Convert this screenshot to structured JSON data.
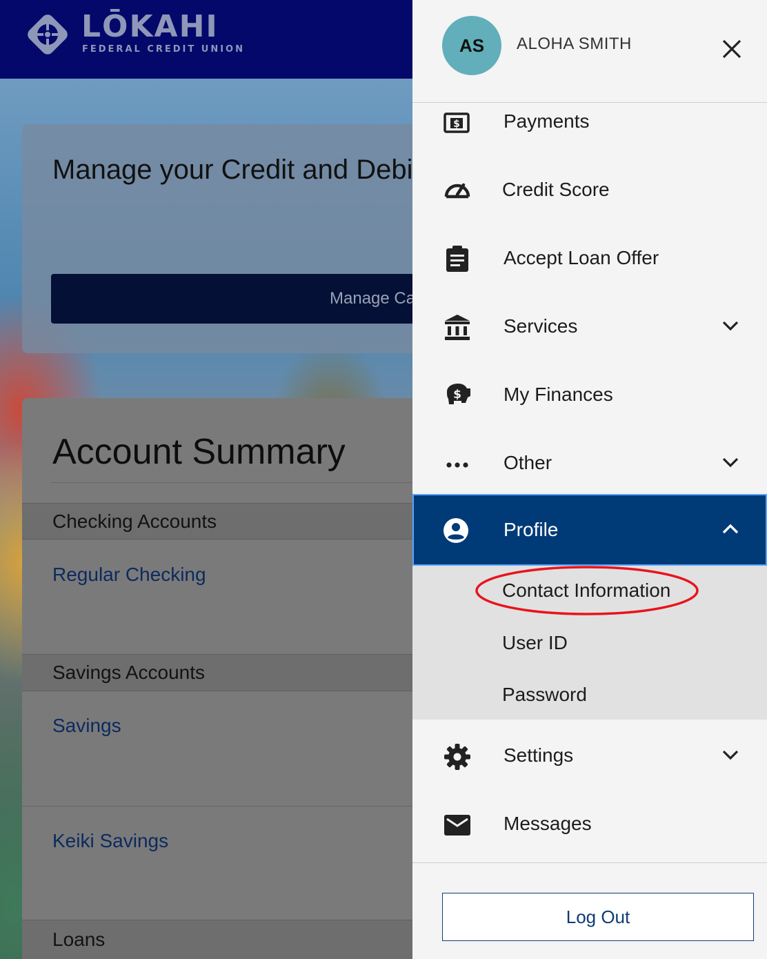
{
  "header": {
    "logo_name": "LŌKAHI",
    "logo_sub": "FEDERAL CREDIT UNION"
  },
  "cards_panel": {
    "title": "Manage your Credit and Debit",
    "button_label": "Manage Car"
  },
  "summary": {
    "title": "Account Summary",
    "sections": {
      "checking": "Checking Accounts",
      "savings": "Savings Accounts",
      "loans": "Loans"
    },
    "accounts": {
      "regular_checking": "Regular Checking",
      "savings": "Savings",
      "keiki_savings": "Keiki Savings"
    }
  },
  "drawer": {
    "user": {
      "initials": "AS",
      "name": "ALOHA SMITH"
    },
    "menu": {
      "payments": "Payments",
      "credit_score": "Credit Score",
      "accept_loan": "Accept Loan Offer",
      "services": "Services",
      "my_finances": "My Finances",
      "other": "Other",
      "profile": "Profile",
      "settings": "Settings",
      "messages": "Messages"
    },
    "profile_submenu": {
      "contact": "Contact Information",
      "user_id": "User ID",
      "password": "Password"
    },
    "logout_label": "Log Out"
  },
  "colors": {
    "header_bg": "#04086a",
    "active_item": "#013b77",
    "avatar": "#62aebb",
    "annotation": "#e8141c"
  },
  "icons": [
    "logo-emblem-icon",
    "close-icon",
    "dollar-bill-icon",
    "gauge-icon",
    "clipboard-icon",
    "bank-icon",
    "piggy-bank-icon",
    "more-dots-icon",
    "user-circle-icon",
    "gear-icon",
    "envelope-icon",
    "chevron-down-icon",
    "chevron-up-icon"
  ]
}
